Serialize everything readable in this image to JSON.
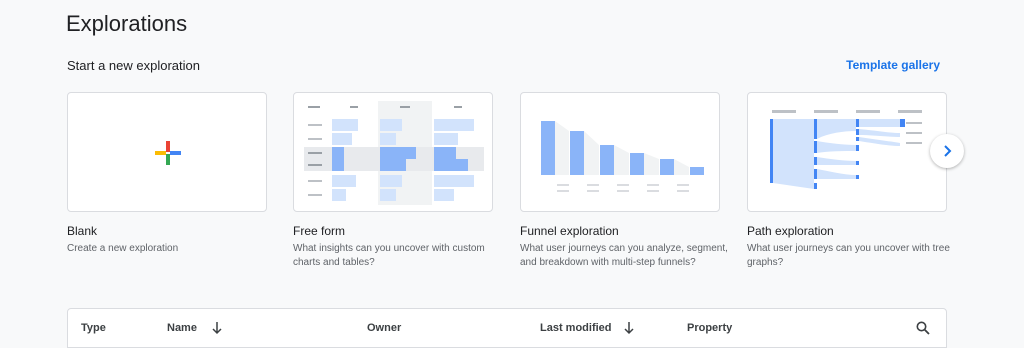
{
  "page": {
    "title": "Explorations"
  },
  "start_section": {
    "title": "Start a new exploration",
    "template_link": "Template gallery"
  },
  "cards": [
    {
      "title": "Blank",
      "description": "Create a new exploration"
    },
    {
      "title": "Free form",
      "description": "What insights can you uncover with custom charts and tables?"
    },
    {
      "title": "Funnel exploration",
      "description": "What user journeys can you analyze, segment, and breakdown with multi-step funnels?"
    },
    {
      "title": "Path exploration",
      "description": "What user journeys can you uncover with tree graphs?"
    }
  ],
  "carousel": {
    "next_icon": "chevron-right-icon"
  },
  "table": {
    "columns": {
      "type": "Type",
      "name": "Name",
      "owner": "Owner",
      "last_modified": "Last modified",
      "property": "Property"
    },
    "sort_icon": "arrow-down-icon",
    "search_icon": "search-icon"
  },
  "colors": {
    "accent": "#1a73e8",
    "bar": "#8ab4f8",
    "bar_dark": "#4285f4",
    "google_blue": "#4285f4",
    "google_red": "#ea4335",
    "google_yellow": "#fbbc04",
    "google_green": "#34a853"
  }
}
